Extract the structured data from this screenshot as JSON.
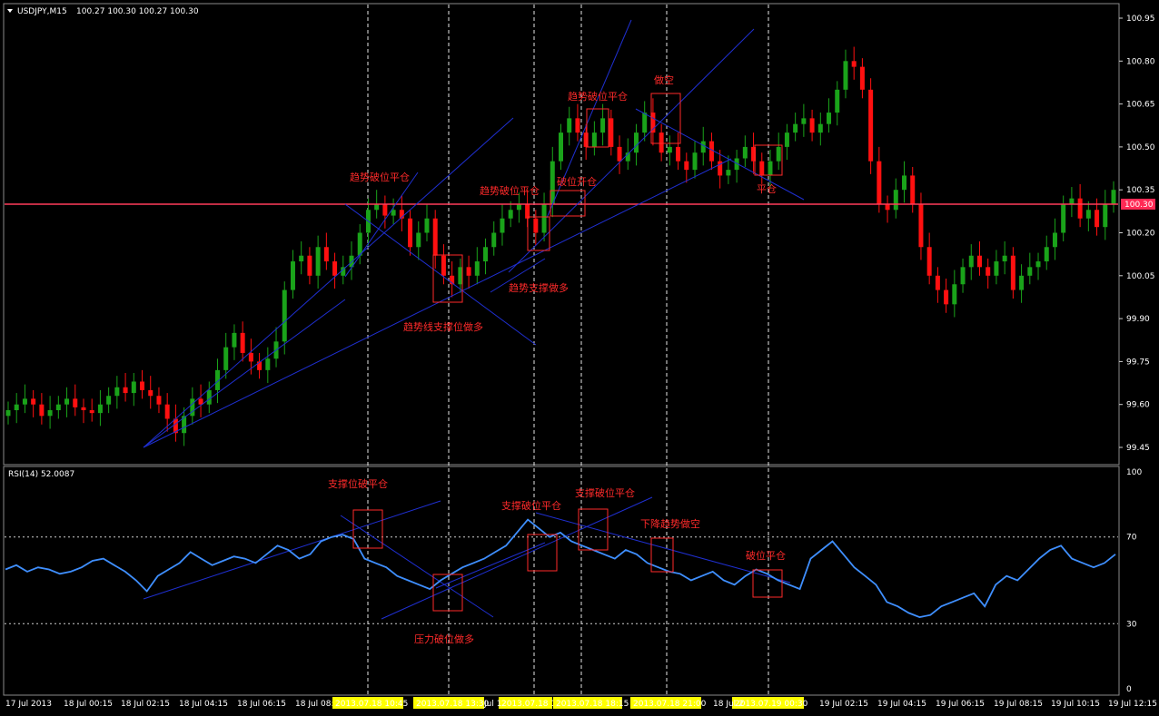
{
  "header": {
    "symbol": "USDJPY,M15",
    "ohlc": "100.27 100.30 100.27 100.30",
    "indicator": "RSI(14) 52.0087"
  },
  "colors": {
    "background": "#000000",
    "bull": "#1aa31a",
    "bear": "#ff1010",
    "trendline": "#1f2fd0",
    "annotation": "#ff2a2a",
    "rsi_line": "#3f8fff",
    "price_line": "#ff3c5a",
    "vline": "#ffffff",
    "axis_text": "#ffffff",
    "highlight_label": "#ffff00"
  },
  "price_axis": {
    "ticks": [
      "100.95",
      "100.80",
      "100.65",
      "100.50",
      "100.35",
      "100.20",
      "100.05",
      "99.90",
      "99.75",
      "99.60",
      "99.45"
    ],
    "current_price": "100.30"
  },
  "rsi_axis": {
    "ticks": [
      "100",
      "70",
      "30",
      "0"
    ]
  },
  "time_axis": {
    "labels": [
      "17 Jul 2013",
      "18 Jul 00:15",
      "18 Jul 02:15",
      "18 Jul 04:15",
      "18 Jul 06:15",
      "18 Jul 08:",
      "19 Jul 02:15",
      "19 Jul 04:15",
      "19 Jul 06:15",
      "19 Jul 08:15",
      "19 Jul 10:15",
      "19 Jul 12:15"
    ],
    "highlights": [
      "2013.07.18 10:45",
      "2013.07.18 13:30",
      "2013.07.18 1",
      "2013.07.18 18:15",
      "2013.07.18 21:00",
      "2013.07.19 00:30"
    ],
    "fragments": [
      "Jul 1",
      "18 Jul 2"
    ]
  },
  "annotations_price": [
    "趋势破位平仓",
    "趋势线支撑位做多",
    "趋势破位平仓",
    "趋势支撑做多",
    "破位开仓",
    "趋势破位平仓",
    "做空",
    "平仓"
  ],
  "annotations_rsi": [
    "支撑位破平仓",
    "压力破位做多",
    "支撑破位平仓",
    "支撑破位平仓",
    "下降趋势做空",
    "破位平仓"
  ],
  "chart_data": {
    "type": "candlestick",
    "symbol": "USDJPY",
    "timeframe": "M15",
    "price_ylim": [
      99.38,
      101.0
    ],
    "rsi_ylim": [
      0,
      100
    ],
    "rsi_levels": [
      70,
      30
    ],
    "current_price": 100.3,
    "price_closes": [
      99.58,
      99.6,
      99.62,
      99.6,
      99.56,
      99.58,
      99.6,
      99.62,
      99.59,
      99.58,
      99.57,
      99.6,
      99.63,
      99.66,
      99.64,
      99.68,
      99.65,
      99.63,
      99.6,
      99.55,
      99.5,
      99.56,
      99.62,
      99.6,
      99.65,
      99.72,
      99.8,
      99.85,
      99.78,
      99.75,
      99.72,
      99.76,
      99.82,
      100.0,
      100.1,
      100.12,
      100.05,
      100.15,
      100.1,
      100.05,
      100.08,
      100.12,
      100.2,
      100.28,
      100.3,
      100.26,
      100.28,
      100.25,
      100.15,
      100.2,
      100.25,
      100.12,
      100.05,
      100.02,
      100.08,
      100.05,
      100.1,
      100.15,
      100.2,
      100.25,
      100.28,
      100.3,
      100.25,
      100.2,
      100.3,
      100.45,
      100.55,
      100.6,
      100.55,
      100.5,
      100.55,
      100.6,
      100.5,
      100.45,
      100.48,
      100.55,
      100.62,
      100.55,
      100.48,
      100.5,
      100.45,
      100.42,
      100.48,
      100.52,
      100.45,
      100.4,
      100.42,
      100.46,
      100.5,
      100.45,
      100.4,
      100.45,
      100.5,
      100.55,
      100.58,
      100.6,
      100.55,
      100.58,
      100.62,
      100.7,
      100.8,
      100.78,
      100.7,
      100.45,
      100.3,
      100.28,
      100.35,
      100.4,
      100.3,
      100.15,
      100.05,
      100.0,
      99.95,
      100.02,
      100.08,
      100.12,
      100.08,
      100.05,
      100.1,
      100.12,
      100.0,
      100.05,
      100.08,
      100.1,
      100.15,
      100.2,
      100.3,
      100.32,
      100.25,
      100.28,
      100.22,
      100.3,
      100.35
    ],
    "rsi_values": [
      55,
      57,
      54,
      56,
      55,
      53,
      54,
      56,
      59,
      60,
      57,
      54,
      50,
      45,
      52,
      55,
      58,
      63,
      60,
      57,
      59,
      61,
      60,
      58,
      62,
      66,
      64,
      60,
      62,
      68,
      70,
      71,
      69,
      60,
      58,
      56,
      52,
      50,
      48,
      46,
      50,
      53,
      56,
      58,
      60,
      63,
      66,
      72,
      78,
      74,
      70,
      72,
      68,
      66,
      64,
      62,
      60,
      64,
      62,
      58,
      56,
      54,
      53,
      50,
      52,
      54,
      50,
      48,
      52,
      55,
      53,
      50,
      48,
      46,
      60,
      64,
      68,
      62,
      56,
      52,
      48,
      40,
      38,
      35,
      33,
      34,
      38,
      40,
      42,
      44,
      38,
      48,
      52,
      50,
      55,
      60,
      64,
      66,
      60,
      58,
      56,
      58,
      62
    ],
    "time_labels": [
      "17 Jul 2013",
      "18 Jul 00:15",
      "18 Jul 02:15",
      "18 Jul 04:15",
      "18 Jul 06:15",
      "18 Jul 08:",
      "19 Jul 02:15",
      "19 Jul 04:15",
      "19 Jul 06:15",
      "19 Jul 08:15",
      "19 Jul 10:15",
      "19 Jul 12:15"
    ],
    "marked_times": [
      "2013.07.18 10:45",
      "2013.07.18 13:30",
      "2013.07.18 1",
      "2013.07.18 18:15",
      "2013.07.18 21:00",
      "2013.07.19 00:30"
    ]
  }
}
